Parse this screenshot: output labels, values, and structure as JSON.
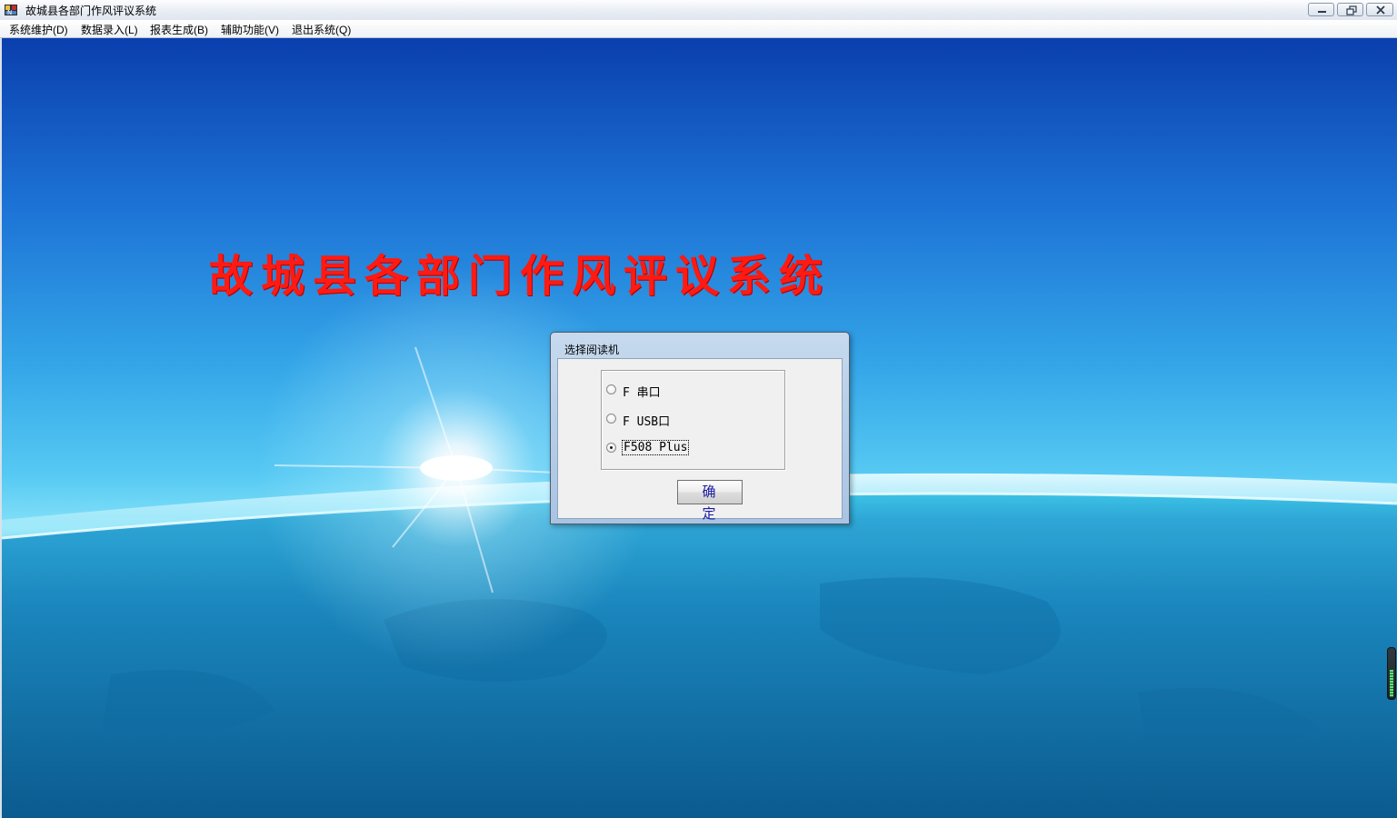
{
  "window": {
    "title": "故城县各部门作风评议系统",
    "controls": {
      "minimize_icon": "minimize-icon",
      "restore_icon": "restore-icon",
      "close_icon": "close-icon"
    }
  },
  "menubar": {
    "items": [
      {
        "label": "系统维护(D)"
      },
      {
        "label": "数据录入(L)"
      },
      {
        "label": "报表生成(B)"
      },
      {
        "label": "辅助功能(V)"
      },
      {
        "label": "退出系统(Q)"
      }
    ]
  },
  "main": {
    "banner_title": "故城县各部门作风评议系统",
    "banner_color": "#ff1a12"
  },
  "dialog": {
    "title": "选择阅读机",
    "options": [
      {
        "label": "F 串口",
        "selected": false
      },
      {
        "label": "F USB口",
        "selected": false
      },
      {
        "label": "F508 Plus",
        "selected": true
      }
    ],
    "ok_label": "确 定"
  }
}
